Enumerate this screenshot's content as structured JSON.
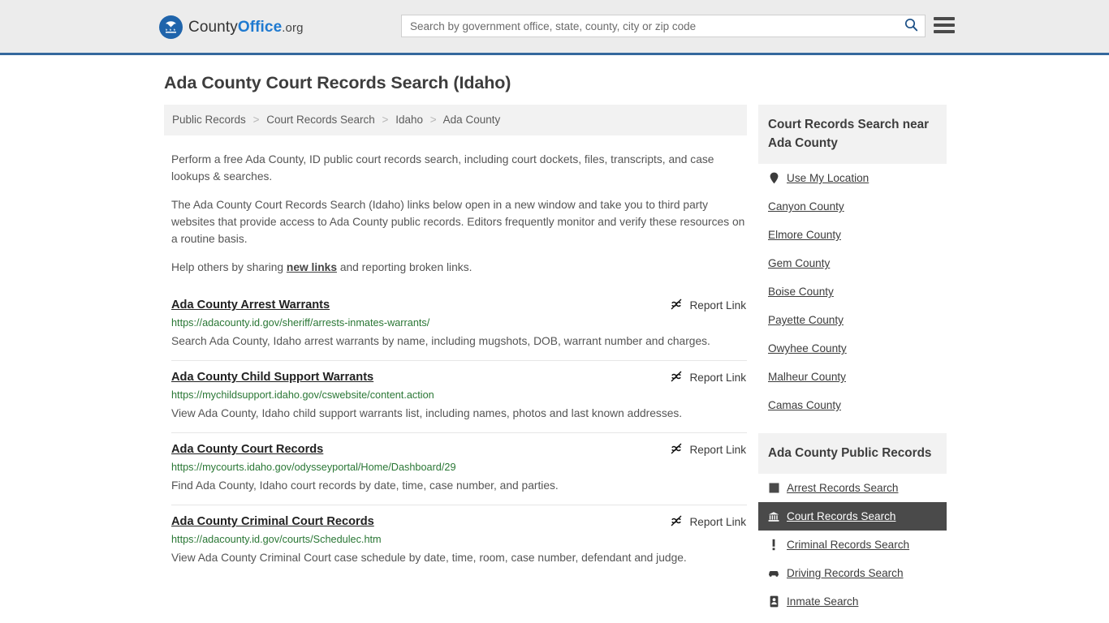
{
  "header": {
    "logo": {
      "icon": "eagle-stars-icon",
      "text_county": "County",
      "text_office": "Office",
      "text_org": ".org"
    },
    "search": {
      "placeholder": "Search by government office, state, county, city or zip code",
      "value": "",
      "search_icon": "search-icon"
    },
    "menu_icon": "hamburger-menu-icon"
  },
  "page": {
    "title": "Ada County Court Records Search (Idaho)"
  },
  "breadcrumb": {
    "separator": ">",
    "items": [
      {
        "label": "Public Records"
      },
      {
        "label": "Court Records Search"
      },
      {
        "label": "Idaho"
      },
      {
        "label": "Ada County"
      }
    ]
  },
  "intro": {
    "p1": "Perform a free Ada County, ID public court records search, including court dockets, files, transcripts, and case lookups & searches.",
    "p2": "The Ada County Court Records Search (Idaho) links below open in a new window and take you to third party websites that provide access to Ada County public records. Editors frequently monitor and verify these resources on a routine basis.",
    "p3_before": "Help others by sharing ",
    "p3_link": "new links",
    "p3_after": " and reporting broken links."
  },
  "results": {
    "report_label": "Report Link",
    "report_icon": "broken-link-icon",
    "items": [
      {
        "title": "Ada County Arrest Warrants",
        "url": "https://adacounty.id.gov/sheriff/arrests-inmates-warrants/",
        "description": "Search Ada County, Idaho arrest warrants by name, including mugshots, DOB, warrant number and charges."
      },
      {
        "title": "Ada County Child Support Warrants",
        "url": "https://mychildsupport.idaho.gov/cswebsite/content.action",
        "description": "View Ada County, Idaho child support warrants list, including names, photos and last known addresses."
      },
      {
        "title": "Ada County Court Records",
        "url": "https://mycourts.idaho.gov/odysseyportal/Home/Dashboard/29",
        "description": "Find Ada County, Idaho court records by date, time, case number, and parties."
      },
      {
        "title": "Ada County Criminal Court Records",
        "url": "https://adacounty.id.gov/courts/Schedulec.htm",
        "description": "View Ada County Criminal Court case schedule by date, time, room, case number, defendant and judge."
      }
    ]
  },
  "sidebar": {
    "nearby": {
      "heading": "Court Records Search near Ada County",
      "use_my_location": {
        "label": "Use My Location",
        "icon": "map-pin-icon"
      },
      "counties": [
        {
          "label": "Canyon County"
        },
        {
          "label": "Elmore County"
        },
        {
          "label": "Gem County"
        },
        {
          "label": "Boise County"
        },
        {
          "label": "Payette County"
        },
        {
          "label": "Owyhee County"
        },
        {
          "label": "Malheur County"
        },
        {
          "label": "Camas County"
        }
      ]
    },
    "public_records": {
      "heading": "Ada County Public Records",
      "items": [
        {
          "label": "Arrest Records Search",
          "icon": "fingerprint-square-icon",
          "active": false
        },
        {
          "label": "Court Records Search",
          "icon": "courthouse-icon",
          "active": true
        },
        {
          "label": "Criminal Records Search",
          "icon": "exclamation-icon",
          "active": false
        },
        {
          "label": "Driving Records Search",
          "icon": "car-icon",
          "active": false
        },
        {
          "label": "Inmate Search",
          "icon": "id-badge-icon",
          "active": false
        }
      ]
    }
  },
  "colors": {
    "brand_blue": "#1f7ad0",
    "header_bg": "#ececec",
    "header_border": "#35689d",
    "url_green": "#2a7735",
    "active_bg": "#4a4a4a"
  }
}
